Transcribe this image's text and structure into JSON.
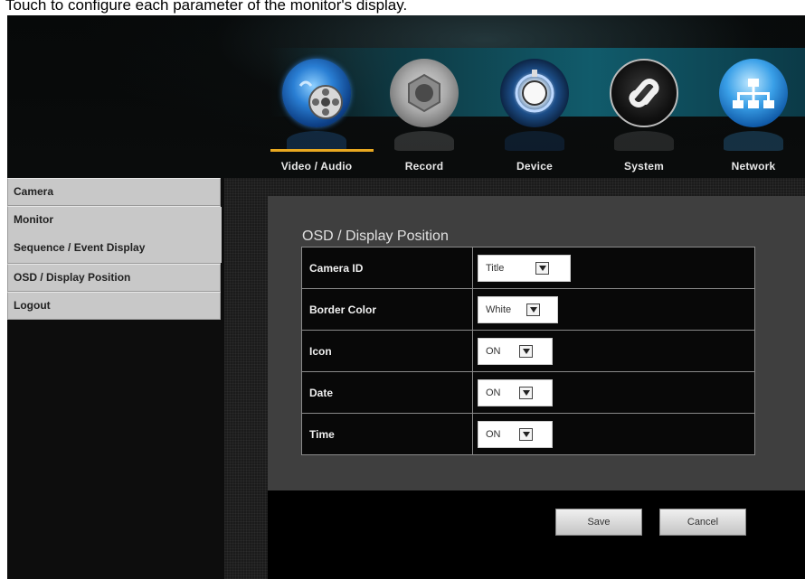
{
  "caption": "Touch to configure each parameter of the monitor's display.",
  "nav": {
    "categories": [
      {
        "label": "Video / Audio",
        "icon": "video-audio-icon",
        "active": true
      },
      {
        "label": "Record",
        "icon": "record-icon",
        "active": false
      },
      {
        "label": "Device",
        "icon": "device-icon",
        "active": false
      },
      {
        "label": "System",
        "icon": "system-icon",
        "active": false
      },
      {
        "label": "Network",
        "icon": "network-icon",
        "active": false
      }
    ],
    "active_underline_color": "#e8a820"
  },
  "sidebar": {
    "items": [
      {
        "label": "Camera"
      },
      {
        "label": "Monitor"
      },
      {
        "label": "Sequence / Event Display"
      },
      {
        "label": "OSD / Display Position"
      },
      {
        "label": "Logout"
      }
    ]
  },
  "panel": {
    "title": "OSD / Display Position",
    "rows": [
      {
        "label": "Camera ID",
        "value": "Title"
      },
      {
        "label": "Border Color",
        "value": "White"
      },
      {
        "label": "Icon",
        "value": "ON"
      },
      {
        "label": "Date",
        "value": "ON"
      },
      {
        "label": "Time",
        "value": "ON"
      }
    ]
  },
  "buttons": {
    "save": "Save",
    "cancel": "Cancel"
  }
}
